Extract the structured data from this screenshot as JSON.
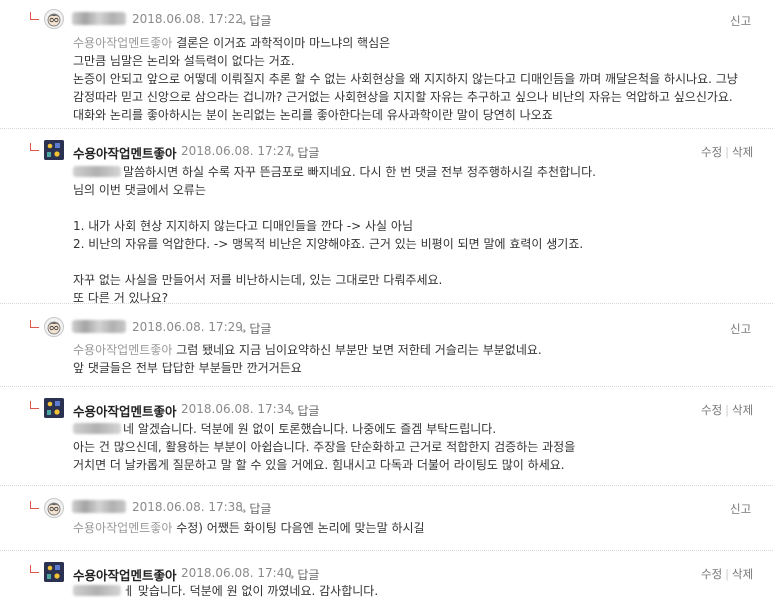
{
  "comments": [
    {
      "nickname": "",
      "date": "2018.06.08. 17:22",
      "reply_label": "답글",
      "action": "신고",
      "mention": "수용아작업멘트좋아",
      "lines": [
        "결론은 이거죠 과학적이마 마느냐의 핵심은",
        "그만큼 님말은 논리와 설득력이 없다는 거죠.",
        "논증이 안되고 앞으로 어떻데 이뤄질지 추론 할 수 없는 사회현상을 왜 지지하지 않는다고 디매인듬을 까며 깨달은척을 하시나요. 그냥",
        "감정따라 믿고 신앙으로 삼으라는 겁니까? 근거없는 사회현상을 지지할 자유는 추구하고 싶으나 비난의 자유는 억압하고 싶으신가요.",
        "대화와 논리를 좋아하시는 분이 논리없는 논리를 좋아한다는데 유사과학이란 말이 당연히 나오죠"
      ]
    },
    {
      "nickname": "수용아작업멘트좋아",
      "date": "2018.06.08. 17:27",
      "reply_label": "답글",
      "edit_label": "수정",
      "delete_label": "삭제",
      "lines": [
        "말씀하시면 하실 수록 자꾸 뜬금포로 빠지네요. 다시 한 번 댓글 전부 정주행하시길 추천합니다.",
        "님의 이번 댓글에서 오류는",
        "",
        "1. 내가 사회 현상 지지하지 않는다고 디매인들을 깐다 -> 사실 아님",
        "2. 비난의 자유를 억압한다. -> 맹목적 비난은 지양해야죠. 근거 있는 비평이 되면 말에 효력이 생기죠.",
        "",
        "자꾸 없는 사실을 만들어서 저를 비난하시는데, 있는 그대로만 다뤄주세요.",
        "또 다른 거 있나요?"
      ]
    },
    {
      "nickname": "",
      "date": "2018.06.08. 17:29",
      "reply_label": "답글",
      "action": "신고",
      "mention": "수용아작업멘트좋아",
      "lines": [
        "그럼 됐네요 지금 님이요약하신 부분만 보면 저한테 거슬리는 부분없네요.",
        "앞 댓글들은 전부 답답한 부분들만 깐거거든요"
      ]
    },
    {
      "nickname": "수용아작업멘트좋아",
      "date": "2018.06.08. 17:34",
      "reply_label": "답글",
      "edit_label": "수정",
      "delete_label": "삭제",
      "lines": [
        "네 알겠습니다. 덕분에 원 없이 토론했습니다. 나중에도 즐겜 부탁드립니다.",
        "아는 건 많으신데, 활용하는 부분이 아쉽습니다. 주장을 단순화하고 근거로 적합한지 검증하는 과정을",
        "거치면 더 날카롭게 질문하고 말 할 수 있을 거에요. 힘내시고 다독과 더불어 라이팅도 많이 하세요."
      ]
    },
    {
      "nickname": "",
      "date": "2018.06.08. 17:38",
      "reply_label": "답글",
      "action": "신고",
      "mention": "수용아작업멘트좋아",
      "lines": [
        "수정) 어쨌든 화이팅 다음엔 논리에 맞는말 하시길"
      ]
    },
    {
      "nickname": "수용아작업멘트좋아",
      "date": "2018.06.08. 17:40",
      "reply_label": "답글",
      "edit_label": "수정",
      "delete_label": "삭제",
      "lines": [
        "ㅔ 맞습니다. 덕분에 원 없이 까였네요. 감사합니다."
      ]
    }
  ],
  "colors": {
    "reply_arrow": "#e0564a",
    "mention": "#999999",
    "divider": "#d8d8d8"
  }
}
